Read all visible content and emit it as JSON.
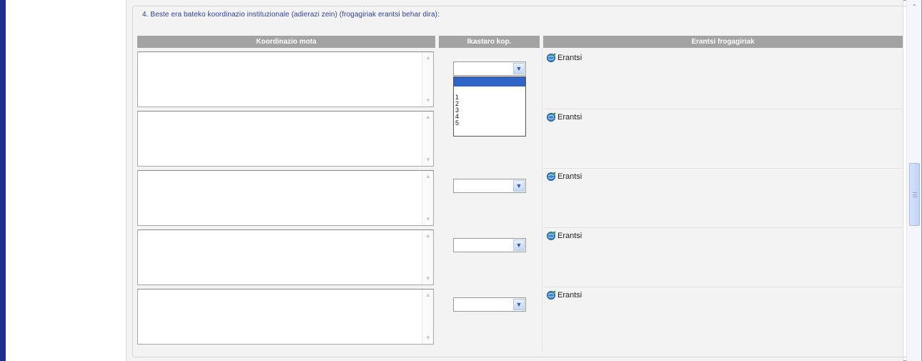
{
  "section": {
    "legend": "4. Beste era bateko koordinazio instituzionale (adierazi zein) (frogagiriak erantsi behar dira):"
  },
  "table": {
    "headers": {
      "mota": "Koordinazio mota",
      "kop": "Ikastaro kop.",
      "erantsi": "Erantsi frogagiriak"
    },
    "rows": [
      {
        "mota_value": "",
        "kop_value": "",
        "attach_label": "Erantsi"
      },
      {
        "mota_value": "",
        "kop_value": "",
        "attach_label": "Erantsi"
      },
      {
        "mota_value": "",
        "kop_value": "",
        "attach_label": "Erantsi"
      },
      {
        "mota_value": "",
        "kop_value": "",
        "attach_label": "Erantsi"
      },
      {
        "mota_value": "",
        "kop_value": "",
        "attach_label": "Erantsi"
      }
    ]
  },
  "dropdown": {
    "open_row": 1,
    "options": [
      "",
      "1",
      "2",
      "3",
      "4",
      "5"
    ],
    "highlighted": ""
  },
  "icons": {
    "attach": "attach-globe-icon",
    "select": "chevron-down-icon",
    "textarea_scroll_up": "arrow-up-icon",
    "textarea_scroll_down": "arrow-down-icon",
    "page_scroll_up": "chevron-up-icon"
  },
  "colors": {
    "accent_bar": "#1f2f8c",
    "legend_text": "#2d3fa0",
    "header_bg": "#a3a3a3",
    "content_bg": "#f3f3f3",
    "dropdown_highlight": "#2f64c6"
  }
}
